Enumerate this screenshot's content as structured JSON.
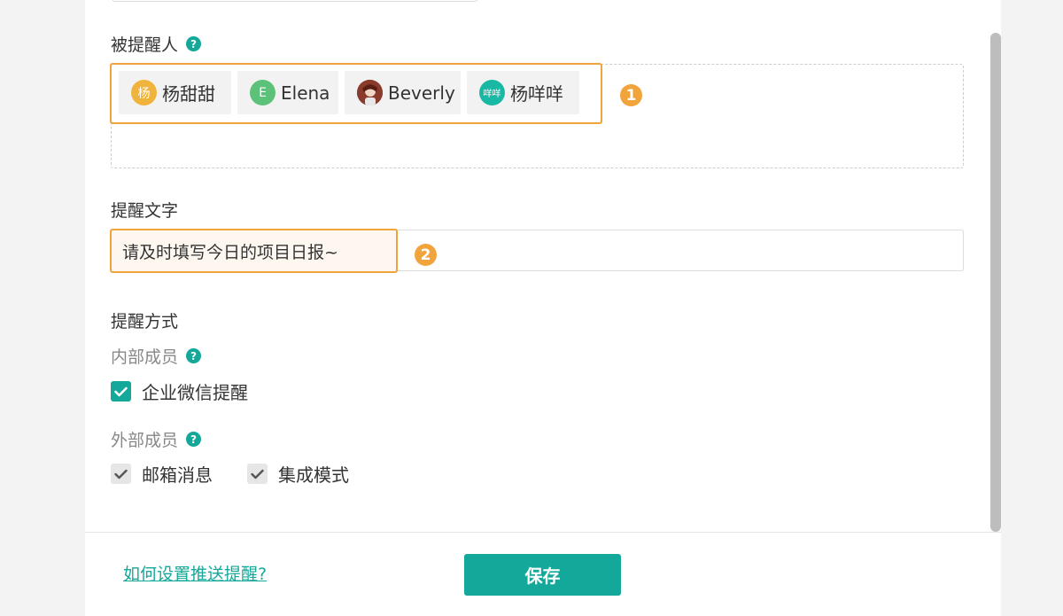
{
  "recipients": {
    "label": "被提醒人",
    "help": "?",
    "chips": [
      {
        "name": "杨甜甜",
        "avatar_text": "杨",
        "avatar_color": "#f0b43c"
      },
      {
        "name": "Elena",
        "avatar_text": "E",
        "avatar_color": "#5cc27a"
      },
      {
        "name": "Beverly",
        "avatar_text": "",
        "avatar_color": "#8a3b2c"
      },
      {
        "name": "杨咩咩",
        "avatar_text": "咩咩",
        "avatar_color": "#19b8a4"
      }
    ],
    "marker": "1"
  },
  "reminder_text": {
    "label": "提醒文字",
    "value": "请及时填写今日的项目日报~",
    "marker": "2"
  },
  "reminder_method": {
    "label": "提醒方式",
    "internal": {
      "label": "内部成员",
      "help": "?",
      "options": [
        {
          "label": "企业微信提醒",
          "checked": true
        }
      ]
    },
    "external": {
      "label": "外部成员",
      "help": "?",
      "options": [
        {
          "label": "邮箱消息",
          "checked": true
        },
        {
          "label": "集成模式",
          "checked": true
        }
      ]
    }
  },
  "footer": {
    "help_link": "如何设置推送提醒?",
    "save_label": "保存"
  },
  "colors": {
    "accent": "#14a89a",
    "highlight": "#f1a43c"
  }
}
